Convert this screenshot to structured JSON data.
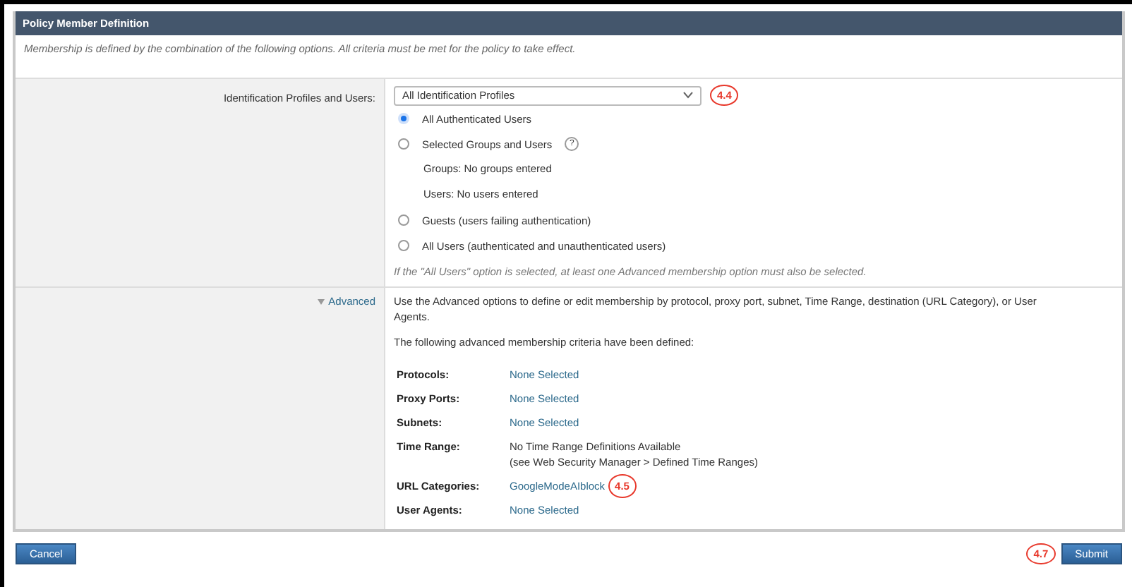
{
  "panel": {
    "title": "Policy Member Definition",
    "description": "Membership is defined by the combination of the following options. All criteria must be met for the policy to take effect."
  },
  "identification": {
    "label": "Identification Profiles and Users:",
    "select_value": "All Identification Profiles",
    "callout": "4.4",
    "options": [
      {
        "label": "All Authenticated Users",
        "selected": true
      },
      {
        "label": "Selected Groups and Users",
        "selected": false,
        "help": "?",
        "details": [
          "Groups: No groups entered",
          "Users: No users entered"
        ]
      },
      {
        "label": "Guests (users failing authentication)",
        "selected": false
      },
      {
        "label": "All Users (authenticated and unauthenticated users)",
        "selected": false
      }
    ],
    "note": "If the \"All Users\" option is selected, at least one Advanced membership option must also be selected."
  },
  "advanced": {
    "toggle": "Advanced",
    "expanded": true,
    "intro": "Use the Advanced options to define or edit membership by protocol, proxy port, subnet, Time Range, destination (URL Category), or User Agents.",
    "subtitle": "The following advanced membership criteria have been defined:",
    "criteria": [
      {
        "label": "Protocols:",
        "kind": "link",
        "lines": [
          "None Selected"
        ]
      },
      {
        "label": "Proxy Ports:",
        "kind": "link",
        "lines": [
          "None Selected"
        ]
      },
      {
        "label": "Subnets:",
        "kind": "link",
        "lines": [
          "None Selected"
        ]
      },
      {
        "label": "Time Range:",
        "kind": "text",
        "lines": [
          "No Time Range Definitions Available",
          "(see Web Security Manager > Defined Time Ranges)"
        ]
      },
      {
        "label": "URL Categories:",
        "kind": "link",
        "lines": [
          "GoogleModeAIblock"
        ],
        "callout": "4.5"
      },
      {
        "label": "User Agents:",
        "kind": "link",
        "lines": [
          "None Selected"
        ]
      }
    ]
  },
  "buttons": {
    "cancel": "Cancel",
    "submit": "Submit",
    "submit_callout": "4.7"
  }
}
